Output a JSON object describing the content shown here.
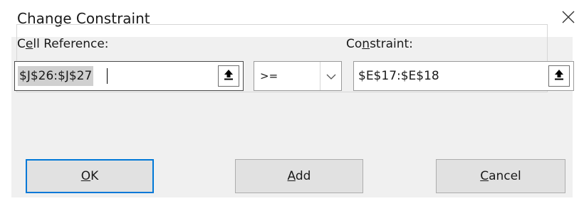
{
  "dialog": {
    "title": "Change Constraint",
    "close_icon": "close-icon"
  },
  "cell_reference": {
    "label_pre": "C",
    "label_accel": "e",
    "label_post": "ll Reference:",
    "value": "$J$26:$J$27",
    "collapse_icon": "collapse-dialog-icon"
  },
  "operator": {
    "selected": ">=",
    "dropdown_icon": "chevron-down-icon"
  },
  "constraint": {
    "label_pre": "Co",
    "label_accel": "n",
    "label_post": "straint:",
    "value": "$E$17:$E$18",
    "collapse_icon": "collapse-dialog-icon"
  },
  "buttons": {
    "ok_accel": "O",
    "ok_post": "K",
    "add_accel": "A",
    "add_post": "dd",
    "cancel_accel": "C",
    "cancel_post": "ancel"
  },
  "colors": {
    "focus_border": "#0078d7",
    "dialog_body": "#f0f0f0",
    "button_face": "#e1e1e1"
  }
}
